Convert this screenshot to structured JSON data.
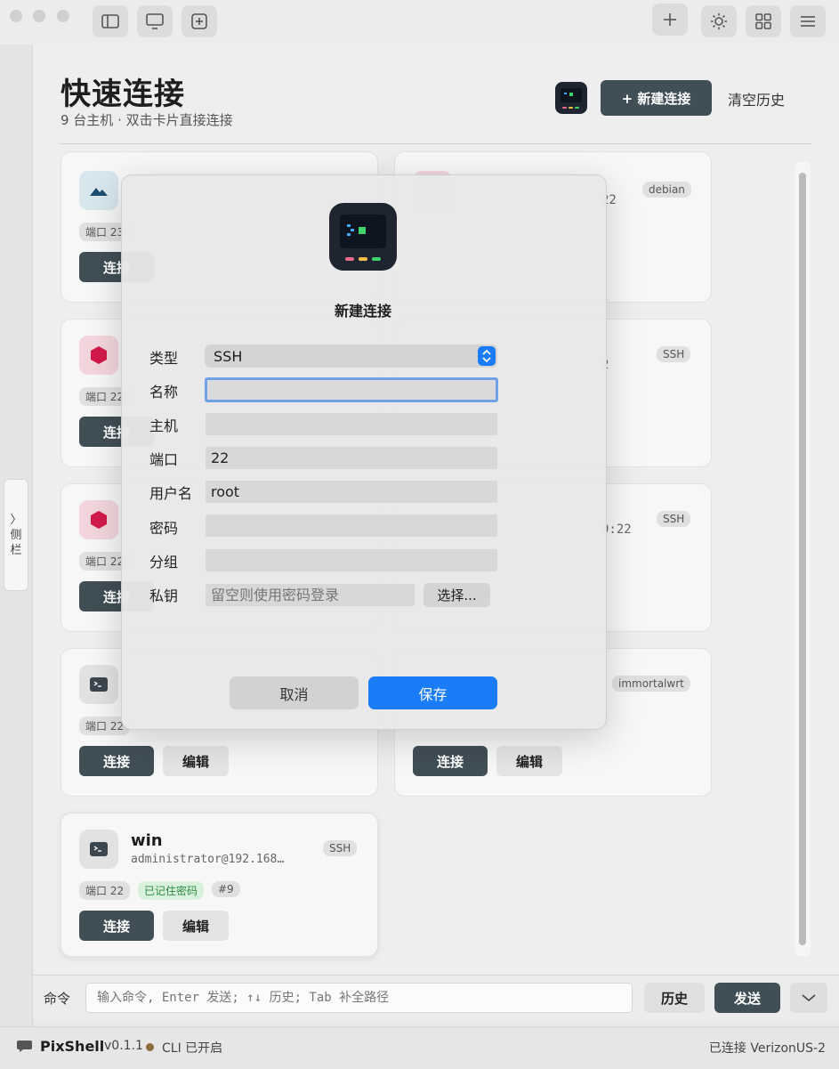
{
  "header": {
    "title": "快速连接",
    "subtitle": "9 台主机 · 双击卡片直接连接",
    "new_button": "+ 新建连接",
    "clear_button": "清空历史"
  },
  "sidebar_tab": {
    "arrow": "〉",
    "label_1": "侧",
    "label_2": "栏"
  },
  "cards": [
    {
      "port": "端口 23",
      "connect": "连接"
    },
    {
      "tag": "debian",
      "host_tail": "22"
    },
    {
      "port": "端口 22",
      "connect": "连接",
      "tag": "SSH",
      "host_tail": "2"
    },
    {
      "port": "端口 22",
      "connect": "连接",
      "tag": "SSH",
      "host_tail": "9:22"
    },
    {
      "port": "端口 22",
      "connect": "连接",
      "edit": "编辑"
    },
    {
      "tag": "immortalwrt",
      "connect": "连接",
      "edit": "编辑"
    },
    {
      "name": "win",
      "host": "administrator@192.168…",
      "tag": "SSH",
      "port": "端口 22",
      "saved": "已记住密码",
      "index": "#9",
      "connect": "连接",
      "edit": "编辑"
    }
  ],
  "modal": {
    "title": "新建连接",
    "labels": {
      "type": "类型",
      "name": "名称",
      "host": "主机",
      "port": "端口",
      "user": "用户名",
      "password": "密码",
      "group": "分组",
      "key": "私钥"
    },
    "values": {
      "type": "SSH",
      "name": "",
      "host": "",
      "port": "22",
      "user": "root",
      "password": "",
      "group": ""
    },
    "key_placeholder": "留空则使用密码登录",
    "choose_button": "选择...",
    "cancel_button": "取消",
    "save_button": "保存"
  },
  "command_bar": {
    "label": "命令",
    "placeholder": "输入命令, Enter 发送; ↑↓ 历史; Tab 补全路径",
    "history_button": "历史",
    "send_button": "发送",
    "expand_icon": "chevron-down-icon"
  },
  "status_bar": {
    "app_name": "PixShell",
    "version": "v0.1.1",
    "cli_status": "CLI 已开启",
    "connection": "已连接 VerizonUS-2"
  },
  "colors": {
    "accent": "#1a7cf7",
    "dark_button": "#404e55",
    "danger_icon": "#d21a4a",
    "status_dot": "#8a6d3b"
  }
}
